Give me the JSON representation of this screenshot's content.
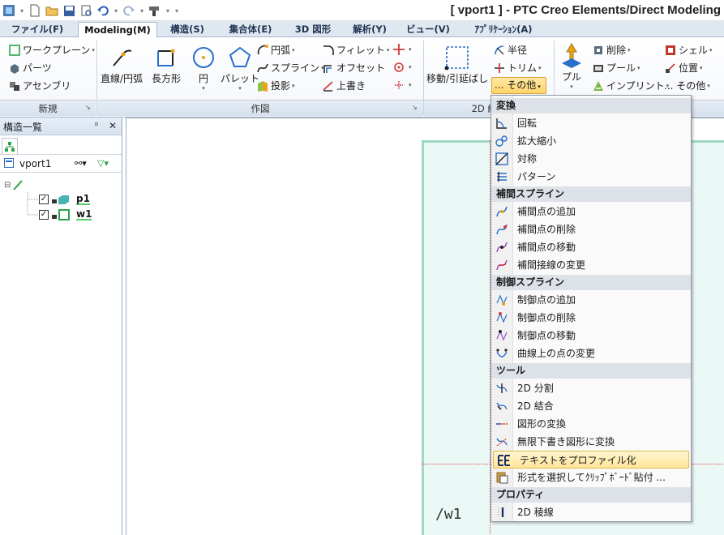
{
  "window": {
    "title": "[ vport1 ] - PTC Creo Elements/Direct Modeling"
  },
  "tabs": [
    {
      "label": "ファイル(F)"
    },
    {
      "label": "Modeling(M)"
    },
    {
      "label": "構造(S)"
    },
    {
      "label": "集合体(E)"
    },
    {
      "label": "3D 図形"
    },
    {
      "label": "解析(Y)"
    },
    {
      "label": "ビュー(V)"
    },
    {
      "label": "ｱﾌﾟﾘｹｰｼｮﾝ(A)"
    }
  ],
  "ribbon": {
    "new_group": {
      "label": "新規",
      "workplane": "ワークプレーン",
      "parts": "パーツ",
      "assembly": "アセンブリ"
    },
    "draw_group": {
      "label": "作図",
      "line_arc": "直線/円弧",
      "rectangle": "長方形",
      "circle": "円",
      "pallet": "パレット",
      "arc": "円弧",
      "spline": "スプライン",
      "projection": "投影",
      "fillet": "フィレット",
      "offset": "オフセット",
      "overwrite": "上書き"
    },
    "edit2d_group": {
      "label": "2D 編集",
      "move_extend": "移動/引延ばし",
      "radius": "半径",
      "trim": "トリム",
      "more": "... その他"
    },
    "solid_group": {
      "pull": "プル",
      "delete": "削除",
      "pool": "プール",
      "imprint": "インプリント",
      "shell": "シェル",
      "position": "位置",
      "more": "... その他"
    }
  },
  "structure_panel": {
    "title": "構造一覧",
    "pin": "ᵖ",
    "close": "✕",
    "viewport": "vport1",
    "items": [
      {
        "name": "p1",
        "checked": "✓"
      },
      {
        "name": "w1",
        "checked": "✓"
      }
    ]
  },
  "canvas": {
    "workplane_label": "/w1"
  },
  "menu": {
    "sections": [
      {
        "header": "変換",
        "items": [
          "回転",
          "拡大縮小",
          "対称",
          "パターン"
        ]
      },
      {
        "header": "補間スプライン",
        "items": [
          "補間点の追加",
          "補間点の削除",
          "補間点の移動",
          "補間接線の変更"
        ]
      },
      {
        "header": "制御スプライン",
        "items": [
          "制御点の追加",
          "制御点の削除",
          "制御点の移動",
          "曲線上の点の変更"
        ]
      },
      {
        "header": "ツール",
        "items": [
          "2D 分割",
          "2D 結合",
          "図形の変換",
          "無限下書き図形に変換",
          "テキストをプロファイル化",
          "形式を選択してｸﾘｯﾌﾟﾎﾞｰﾄﾞ貼付 ..."
        ]
      },
      {
        "header": "プロパティ",
        "items": [
          "2D 稜線"
        ]
      }
    ],
    "highlighted": "テキストをプロファイル化"
  }
}
